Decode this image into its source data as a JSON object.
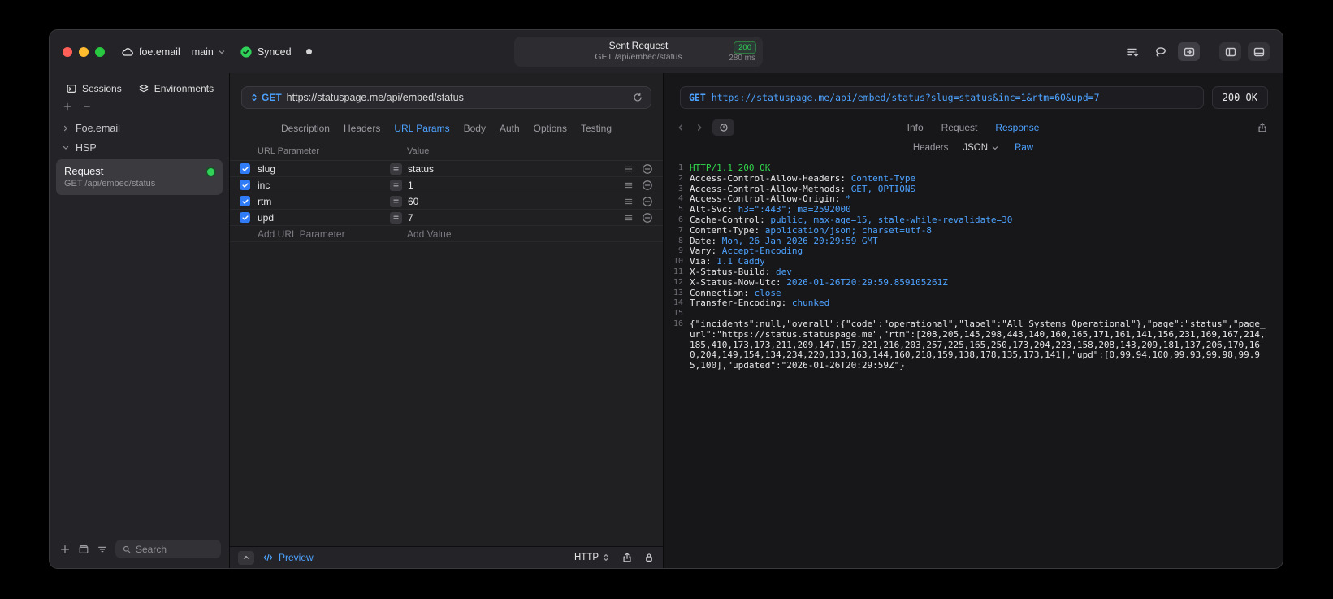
{
  "titlebar": {
    "project": "foe.email",
    "branch": "main",
    "sync_status": "Synced",
    "summary": {
      "title": "Sent Request",
      "status_code": "200",
      "subtitle": "GET /api/embed/status",
      "duration": "280 ms"
    }
  },
  "sidebar": {
    "tabs": [
      "Sessions",
      "Environments"
    ],
    "tree": [
      "Foe.email",
      "HSP"
    ],
    "request": {
      "title": "Request",
      "subtitle": "GET /api/embed/status"
    },
    "search_placeholder": "Search"
  },
  "request_pane": {
    "method": "GET",
    "url": "https://statuspage.me/api/embed/status",
    "tabs": [
      "Description",
      "Headers",
      "URL Params",
      "Body",
      "Auth",
      "Options",
      "Testing"
    ],
    "active_tab": "URL Params",
    "params": {
      "col_name": "URL Parameter",
      "col_value": "Value",
      "rows": [
        {
          "name": "slug",
          "value": "status"
        },
        {
          "name": "inc",
          "value": "1"
        },
        {
          "name": "rtm",
          "value": "60"
        },
        {
          "name": "upd",
          "value": "7"
        }
      ],
      "add_name": "Add URL Parameter",
      "add_value": "Add Value"
    },
    "footer": {
      "preview": "Preview",
      "protocol": "HTTP"
    }
  },
  "response_pane": {
    "method": "GET",
    "url": "https://statuspage.me/api/embed/status?slug=status&inc=1&rtm=60&upd=7",
    "status": "200 OK",
    "tabs": [
      "Info",
      "Request",
      "Response"
    ],
    "active_tab": "Response",
    "subtabs": [
      "Headers",
      "JSON",
      "Raw"
    ],
    "active_subtab": "Raw",
    "colors": {
      "accent_blue": "#4da2ff",
      "status_green": "#32d74b",
      "checkbox_blue": "#2f7cf6"
    },
    "body_lines": [
      {
        "n": "1",
        "parts": [
          {
            "t": "HTTP/1.1 200 OK",
            "c": "green"
          }
        ]
      },
      {
        "n": "2",
        "parts": [
          {
            "t": "Access-Control-Allow-Headers: ",
            "c": "plain"
          },
          {
            "t": "Content-Type",
            "c": "blue"
          }
        ]
      },
      {
        "n": "3",
        "parts": [
          {
            "t": "Access-Control-Allow-Methods: ",
            "c": "plain"
          },
          {
            "t": "GET, OPTIONS",
            "c": "blue"
          }
        ]
      },
      {
        "n": "4",
        "parts": [
          {
            "t": "Access-Control-Allow-Origin: ",
            "c": "plain"
          },
          {
            "t": "*",
            "c": "blue"
          }
        ]
      },
      {
        "n": "5",
        "parts": [
          {
            "t": "Alt-Svc: ",
            "c": "plain"
          },
          {
            "t": "h3=\":443\"; ma=2592000",
            "c": "blue"
          }
        ]
      },
      {
        "n": "6",
        "parts": [
          {
            "t": "Cache-Control: ",
            "c": "plain"
          },
          {
            "t": "public, max-age=15, stale-while-revalidate=30",
            "c": "blue"
          }
        ]
      },
      {
        "n": "7",
        "parts": [
          {
            "t": "Content-Type: ",
            "c": "plain"
          },
          {
            "t": "application/json; charset=utf-8",
            "c": "blue"
          }
        ]
      },
      {
        "n": "8",
        "parts": [
          {
            "t": "Date: ",
            "c": "plain"
          },
          {
            "t": "Mon, 26 Jan 2026 20:29:59 GMT",
            "c": "blue"
          }
        ]
      },
      {
        "n": "9",
        "parts": [
          {
            "t": "Vary: ",
            "c": "plain"
          },
          {
            "t": "Accept-Encoding",
            "c": "blue"
          }
        ]
      },
      {
        "n": "10",
        "parts": [
          {
            "t": "Via: ",
            "c": "plain"
          },
          {
            "t": "1.1 Caddy",
            "c": "blue"
          }
        ]
      },
      {
        "n": "11",
        "parts": [
          {
            "t": "X-Status-Build: ",
            "c": "plain"
          },
          {
            "t": "dev",
            "c": "blue"
          }
        ]
      },
      {
        "n": "12",
        "parts": [
          {
            "t": "X-Status-Now-Utc: ",
            "c": "plain"
          },
          {
            "t": "2026-01-26T20:29:59.859105261Z",
            "c": "blue"
          }
        ]
      },
      {
        "n": "13",
        "parts": [
          {
            "t": "Connection: ",
            "c": "plain"
          },
          {
            "t": "close",
            "c": "blue"
          }
        ]
      },
      {
        "n": "14",
        "parts": [
          {
            "t": "Transfer-Encoding: ",
            "c": "plain"
          },
          {
            "t": "chunked",
            "c": "blue"
          }
        ]
      },
      {
        "n": "15",
        "parts": []
      },
      {
        "n": "16",
        "parts": [
          {
            "t": "{\"incidents\":null,\"overall\":{\"code\":\"operational\",\"label\":\"All Systems Operational\"},\"page\":\"status\",\"page_url\":\"https://status.statuspage.me\",\"rtm\":[208,205,145,298,443,140,160,165,171,161,141,156,231,169,167,214,185,410,173,173,211,209,147,157,221,216,203,257,225,165,250,173,204,223,158,208,143,209,181,137,206,170,160,204,149,154,134,234,220,133,163,144,160,218,159,138,178,135,173,141],\"upd\":[0,99.94,100,99.93,99.98,99.95,100],\"updated\":\"2026-01-26T20:29:59Z\"}",
            "c": "plain"
          }
        ]
      }
    ]
  }
}
